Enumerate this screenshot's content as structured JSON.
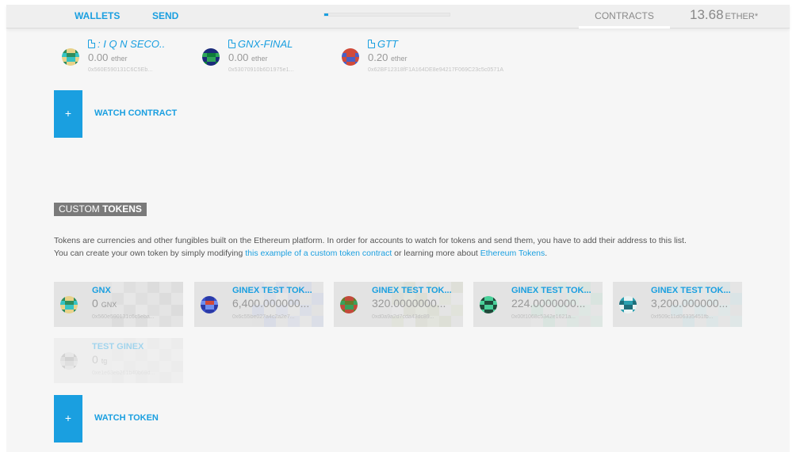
{
  "header": {
    "nav": {
      "wallets": "WALLETS",
      "send": "SEND",
      "contracts": "CONTRACTS"
    },
    "sync_progress": 0.03,
    "balance": {
      "amount": "13.68",
      "unit": "ETHER*"
    }
  },
  "contracts": [
    {
      "name": ": I Q N SECO..",
      "amount": "0.00",
      "unit": "ether",
      "address": "0x560E590131C6C5Eb...",
      "identicon": [
        "#2f8d5c",
        "#e7d28a",
        "#e7d28a",
        "#2f8d5c",
        "#35c3c3",
        "#2f8d5c",
        "#2f8d5c",
        "#35c3c3",
        "#e7d28a",
        "#35c3c3",
        "#35c3c3",
        "#e7d28a",
        "#2f8d5c",
        "#e7d28a",
        "#e7d28a",
        "#2f8d5c"
      ]
    },
    {
      "name": "GNX-FINAL",
      "amount": "0.00",
      "unit": "ether",
      "address": "0x53070910b6D1975e1...",
      "identicon": [
        "#1b2b7a",
        "#1b2b7a",
        "#1b2b7a",
        "#1b2b7a",
        "#2fa55a",
        "#0d7d3a",
        "#0d7d3a",
        "#2fa55a",
        "#1b2b7a",
        "#2fa55a",
        "#2fa55a",
        "#1b2b7a",
        "#0d7d3a",
        "#1b2b7a",
        "#1b2b7a",
        "#0d7d3a"
      ]
    },
    {
      "name": "GTT",
      "amount": "0.20",
      "unit": "ether",
      "address": "0x62BF12318fF1A164DE8e94217F069C23c5c0571A",
      "identicon": [
        "#d04a3a",
        "#d04a3a",
        "#d04a3a",
        "#d04a3a",
        "#4a5fc4",
        "#d04a3a",
        "#d04a3a",
        "#4a5fc4",
        "#d04a3a",
        "#4a5fc4",
        "#4a5fc4",
        "#d04a3a",
        "#4a5fc4",
        "#d04a3a",
        "#d04a3a",
        "#4a5fc4"
      ]
    }
  ],
  "watch_contract": {
    "plus": "+",
    "label": "WATCH CONTRACT"
  },
  "custom_tokens": {
    "title_light": "CUSTOM",
    "title_bold": "TOKENS",
    "description": {
      "line1": "Tokens are currencies and other fungibles built on the Ethereum platform. In order for accounts to watch for tokens and send them, you have to add their address to this list.",
      "line2_prefix": "You can create your own token by simply modifying ",
      "link1": "this example of a custom token contract",
      "line2_middle": " or learning more about ",
      "link2": "Ethereum Tokens",
      "line2_suffix": "."
    },
    "tokens": [
      {
        "name": "GNX",
        "amount": "0",
        "unit": "GNX",
        "address": "0x560e590131c6c5eba...",
        "identicon": [
          "#2f8d5c",
          "#e7d28a",
          "#e7d28a",
          "#2f8d5c",
          "#35c3c3",
          "#2f8d5c",
          "#2f8d5c",
          "#35c3c3",
          "#e7d28a",
          "#35c3c3",
          "#35c3c3",
          "#e7d28a",
          "#2f8d5c",
          "#e7d28a",
          "#e7d28a",
          "#2f8d5c"
        ],
        "bg": [
          "#ececec",
          "#d8d8d8",
          "#e8e8e8",
          "#d4d4d4",
          "#e6e6e6",
          "#dcdcdc"
        ]
      },
      {
        "name": "GINEX TEST TOK...",
        "amount": "6,400.000000...",
        "unit": "",
        "address": "0x6c55be027a4c2a2e7...",
        "identicon": [
          "#3a4ec8",
          "#2a3aa8",
          "#2a3aa8",
          "#3a4ec8",
          "#6f8ff0",
          "#d04a3a",
          "#d04a3a",
          "#6f8ff0",
          "#2a3aa8",
          "#6f8ff0",
          "#6f8ff0",
          "#2a3aa8",
          "#3a4ec8",
          "#2a3aa8",
          "#2a3aa8",
          "#3a4ec8"
        ],
        "bg": [
          "#d9def0",
          "#e7e7e7",
          "#cfd5ea",
          "#e2e2e2",
          "#d3d8ec",
          "#ebebeb"
        ]
      },
      {
        "name": "GINEX TEST TOK...",
        "amount": "320.0000000...",
        "unit": "",
        "address": "0xd0a9a2d7cda43dc89...",
        "identicon": [
          "#6a7a2a",
          "#c24a3a",
          "#c24a3a",
          "#6a7a2a",
          "#3aa05a",
          "#6a7a2a",
          "#6a7a2a",
          "#3aa05a",
          "#c24a3a",
          "#3aa05a",
          "#3aa05a",
          "#c24a3a",
          "#6a7a2a",
          "#c24a3a",
          "#c24a3a",
          "#6a7a2a"
        ],
        "bg": [
          "#e2e6d6",
          "#d9dccc",
          "#ebebeb",
          "#dfe3d2",
          "#e6e6e6",
          "#d6dbc8"
        ]
      },
      {
        "name": "GINEX TEST TOK...",
        "amount": "224.0000000...",
        "unit": "",
        "address": "0x00f1068c5342e1621a...",
        "identicon": [
          "#1f4a3a",
          "#4ad09a",
          "#4ad09a",
          "#1f4a3a",
          "#4ad09a",
          "#1f4a3a",
          "#1f4a3a",
          "#4ad09a",
          "#1f4a3a",
          "#4ad09a",
          "#4ad09a",
          "#1f4a3a",
          "#4ad09a",
          "#1f4a3a",
          "#1f4a3a",
          "#4ad09a"
        ],
        "bg": [
          "#d6ebe2",
          "#e6e6e6",
          "#cfe6db",
          "#e9e9e9",
          "#d9ede4",
          "#e2e2e2"
        ]
      },
      {
        "name": "GINEX TEST TOK...",
        "amount": "3,200.000000...",
        "unit": "",
        "address": "0xf509c11d06335451fb...",
        "identicon": [
          "#2aa0b0",
          "#e9f2f2",
          "#e9f2f2",
          "#2aa0b0",
          "#1e6e7a",
          "#2aa0b0",
          "#2aa0b0",
          "#1e6e7a",
          "#e9f2f2",
          "#1e6e7a",
          "#1e6e7a",
          "#e9f2f2",
          "#2aa0b0",
          "#e9f2f2",
          "#e9f2f2",
          "#2aa0b0"
        ],
        "bg": [
          "#d6eaed",
          "#e8e8e8",
          "#d0e6ea",
          "#e4e4e4",
          "#dbecee",
          "#e9e9e9"
        ]
      },
      {
        "name": "TEST GINEX",
        "amount": "0",
        "unit": "tg",
        "address": "0xe1e63eb261b40b69d...",
        "identicon": [
          "#9a9a9a",
          "#cfcfcf",
          "#cfcfcf",
          "#9a9a9a",
          "#bcbcbc",
          "#9a9a9a",
          "#9a9a9a",
          "#bcbcbc",
          "#cfcfcf",
          "#bcbcbc",
          "#bcbcbc",
          "#cfcfcf",
          "#9a9a9a",
          "#cfcfcf",
          "#cfcfcf",
          "#9a9a9a"
        ],
        "bg": [
          "#e4e4e4",
          "#d6d6d6",
          "#e9e9e9",
          "#dadada",
          "#e6e6e6",
          "#d8d8d8"
        ]
      }
    ]
  },
  "watch_token": {
    "plus": "+",
    "label": "WATCH TOKEN"
  },
  "colors": {
    "accent": "#1a9fe0",
    "background": "#f6f6f6",
    "header": "#efefef",
    "section_title_bg": "#7a7a7a"
  }
}
